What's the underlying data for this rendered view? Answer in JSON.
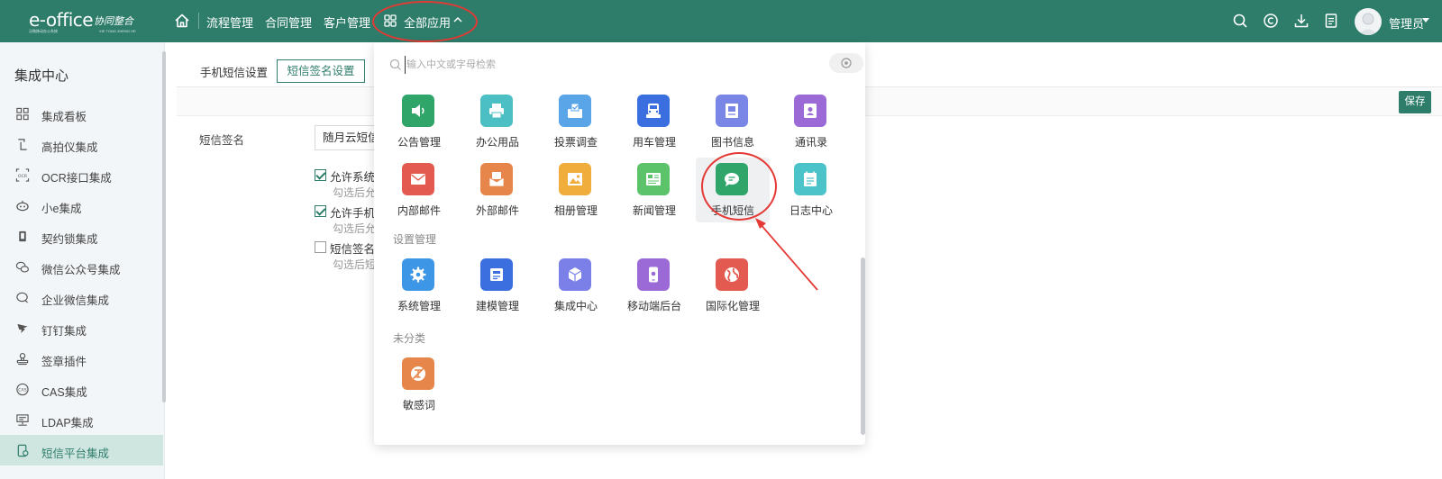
{
  "brand": {
    "logo_text": "e-office",
    "logo_cn": "协同整合",
    "logo_sub": "泛微移动办公系统",
    "logo_sub2": "XIE TONG ZHENG HE"
  },
  "topnav": {
    "items": [
      "流程管理",
      "合同管理",
      "客户管理"
    ],
    "apps_label": "全部应用",
    "user_name": "管理员"
  },
  "sidebar": {
    "title": "集成中心",
    "items": [
      {
        "label": "集成看板",
        "icon": "dashboard-icon"
      },
      {
        "label": "高拍仪集成",
        "icon": "scanner-icon"
      },
      {
        "label": "OCR接口集成",
        "icon": "ocr-icon"
      },
      {
        "label": "小e集成",
        "icon": "robot-icon"
      },
      {
        "label": "契约锁集成",
        "icon": "lock-icon"
      },
      {
        "label": "微信公众号集成",
        "icon": "wechat-icon"
      },
      {
        "label": "企业微信集成",
        "icon": "wework-icon"
      },
      {
        "label": "钉钉集成",
        "icon": "dingtalk-icon"
      },
      {
        "label": "签章插件",
        "icon": "seal-icon"
      },
      {
        "label": "CAS集成",
        "icon": "cas-icon"
      },
      {
        "label": "LDAP集成",
        "icon": "ldap-icon"
      },
      {
        "label": "短信平台集成",
        "icon": "sms-platform-icon",
        "active": true
      }
    ]
  },
  "main": {
    "tab_sms_settings": "手机短信设置",
    "tab_signature_settings": "短信签名设置",
    "save_label": "保存",
    "signature_label": "短信签名",
    "signature_value": "随月云短信",
    "options": [
      {
        "label": "允许系统",
        "checked": true,
        "hint": "勾选后允"
      },
      {
        "label": "允许手机",
        "checked": true,
        "hint": "勾选后允"
      },
      {
        "label": "短信签名",
        "checked": false,
        "hint": "勾选后短"
      }
    ]
  },
  "apps_panel": {
    "search_placeholder": "输入中文或字母检索",
    "apps_row1": [
      {
        "name": "公告管理",
        "color": "#2fa56a",
        "icon": "speaker-icon"
      },
      {
        "name": "办公用品",
        "color": "#4cbfc4",
        "icon": "printer-icon"
      },
      {
        "name": "投票调查",
        "color": "#5aa5e8",
        "icon": "vote-icon"
      },
      {
        "name": "用车管理",
        "color": "#3b6fe0",
        "icon": "car-icon"
      },
      {
        "name": "图书信息",
        "color": "#7a86e6",
        "icon": "book-icon"
      },
      {
        "name": "通讯录",
        "color": "#9b6ad6",
        "icon": "contacts-icon"
      }
    ],
    "apps_row2": [
      {
        "name": "内部邮件",
        "color": "#e25a50",
        "icon": "mail-icon"
      },
      {
        "name": "外部邮件",
        "color": "#e7864a",
        "icon": "external-mail-icon"
      },
      {
        "name": "相册管理",
        "color": "#f0ad3c",
        "icon": "photo-icon"
      },
      {
        "name": "新闻管理",
        "color": "#5cc36b",
        "icon": "news-icon"
      },
      {
        "name": "手机短信",
        "color": "#2fa56a",
        "icon": "chat-icon"
      },
      {
        "name": "日志中心",
        "color": "#4cc3c9",
        "icon": "log-icon"
      }
    ],
    "group_settings": "设置管理",
    "apps_settings": [
      {
        "name": "系统管理",
        "color": "#3e97e6",
        "icon": "gear-icon"
      },
      {
        "name": "建模管理",
        "color": "#3b6fe0",
        "icon": "model-icon"
      },
      {
        "name": "集成中心",
        "color": "#7a80e8",
        "icon": "cube-icon"
      },
      {
        "name": "移动端后台",
        "color": "#9b6ad6",
        "icon": "mobile-icon"
      },
      {
        "name": "国际化管理",
        "color": "#e25a50",
        "icon": "globe-icon"
      }
    ],
    "group_uncategorized": "未分类",
    "apps_uncategorized": [
      {
        "name": "敏感词",
        "color": "#e7864a",
        "icon": "sensitive-word-icon"
      }
    ]
  },
  "colors": {
    "brand": "#2e7d6b",
    "annotation": "#e53935"
  }
}
